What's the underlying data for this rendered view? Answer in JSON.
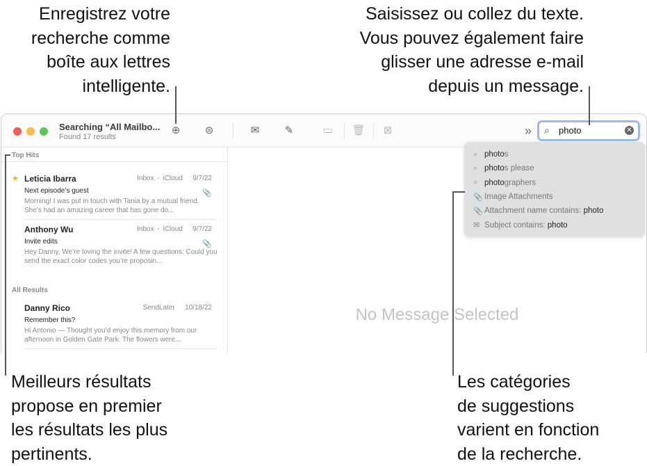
{
  "callouts": {
    "top_left": [
      "Enregistrez votre",
      "recherche comme",
      "boîte aux lettres",
      "intelligente."
    ],
    "top_right": [
      "Saisissez ou collez du texte.",
      "Vous pouvez également faire",
      "glisser une adresse e-mail",
      "depuis un message."
    ],
    "bottom_left": [
      "Meilleurs résultats",
      "propose en premier",
      "les résultats les plus",
      "pertinents."
    ],
    "bottom_right": [
      "Les catégories",
      "de suggestions",
      "varient en fonction",
      "de la recherche."
    ]
  },
  "toolbar": {
    "title": "Searching “All Mailbo...",
    "subtitle": "Found 17 results",
    "search_value": "photo",
    "more": "»"
  },
  "sections": {
    "top_hits": "Top Hits",
    "all_results": "All Results"
  },
  "messages": [
    {
      "from": "Leticia Ibarra",
      "mailbox": "Inbox - iCloud",
      "date": "9/7/22",
      "subject": "Next episode’s guest",
      "preview": "Morning! I was put in touch with Tania by a mutual friend. She’s had an amazing career that has gone do...",
      "flagged": true,
      "attachment": true
    },
    {
      "from": "Anthony Wu",
      "mailbox": "Inbox - iCloud",
      "date": "9/7/22",
      "subject": "Invite edits",
      "preview": "Hey Danny, We’re loving the invite! A few questions: Could you send the exact color codes you’re proposin...",
      "flagged": false,
      "attachment": true
    },
    {
      "from": "Danny Rico",
      "mailbox": "SendLater",
      "date": "10/18/22",
      "subject": "Remember this?",
      "preview": "Hi Antonio — Thought you’d enjoy this memory from our afternoon in Golden Gate Park. The flowers were...",
      "flagged": false,
      "attachment": false
    }
  ],
  "empty_state": "No Message Selected",
  "suggestions": [
    {
      "icon": "search-icon",
      "bold": "photo",
      "rest": "s"
    },
    {
      "icon": "search-icon",
      "bold": "photo",
      "rest": "s please"
    },
    {
      "icon": "search-icon",
      "bold": "photo",
      "rest": "graphers"
    },
    {
      "icon": "paperclip-icon",
      "label": "Image Attachments"
    },
    {
      "icon": "paperclip-icon",
      "label": "Attachment name contains: ",
      "value": "photo"
    },
    {
      "icon": "envelope-icon",
      "label": "Subject contains: ",
      "value": "photo"
    }
  ],
  "colors": {
    "close": "#ee5f58",
    "minimize": "#f5bd4f",
    "zoom": "#5fc454",
    "search_focus": "#9ab8f0",
    "star": "#f4b400"
  }
}
